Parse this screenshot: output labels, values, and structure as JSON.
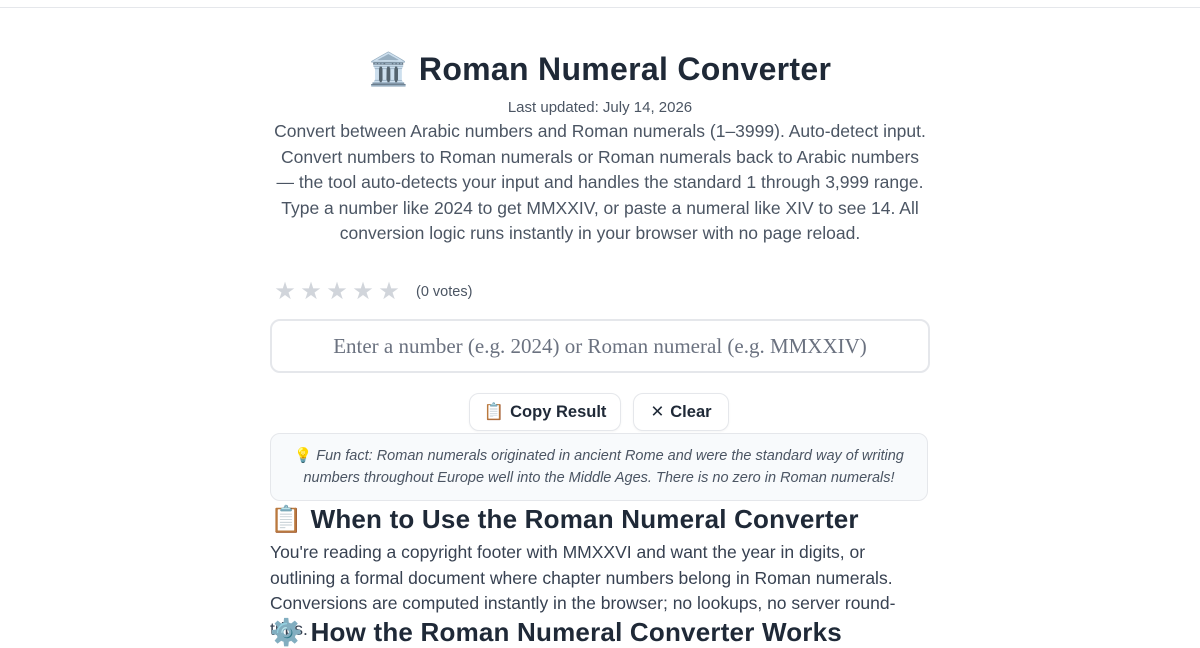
{
  "header": {
    "title_icon": "🏛️",
    "title": "Roman Numeral Converter",
    "updated": "Last updated: July 14, 2026"
  },
  "intro": {
    "line1": "Convert between Arabic numbers and Roman numerals (1–3999). Auto-detect input.",
    "line2": "Convert numbers to Roman numerals or Roman numerals back to Arabic numbers — the tool auto-detects your input and handles the standard 1 through 3,999 range. Type a number like 2024 to get MMXXIV, or paste a numeral like XIV to see 14. All conversion logic runs instantly in your browser with no page reload."
  },
  "rating": {
    "star_glyph": "★",
    "stars": 5,
    "value": 0,
    "votes": "(0 votes)"
  },
  "converter": {
    "value": "",
    "placeholder": "Enter a number (e.g. 2024) or Roman numeral (e.g. MMXXIV)"
  },
  "actions": {
    "copy_icon": "📋",
    "copy_label": "Copy Result",
    "clear_icon": "✕",
    "clear_label": "Clear"
  },
  "fun_fact": {
    "icon": "💡",
    "text": "Fun fact: Roman numerals originated in ancient Rome and were the standard way of writing numbers throughout Europe well into the Middle Ages. There is no zero in Roman numerals!"
  },
  "sections": {
    "when_icon": "📋",
    "when_title": "When to Use the Roman Numeral Converter",
    "when_text": "You're reading a copyright footer with MMXXVI and want the year in digits, or outlining a formal document where chapter numbers belong in Roman numerals. Conversions are computed instantly in the browser; no lookups, no server round-trips.",
    "how_icon": "⚙️",
    "how_title": "How the Roman Numeral Converter Works"
  },
  "colors": {
    "text": "#1f2937",
    "muted": "#4b5563",
    "border": "#e5e7eb",
    "star_empty": "#d1d5db",
    "callout_bg": "#f8fafc"
  }
}
